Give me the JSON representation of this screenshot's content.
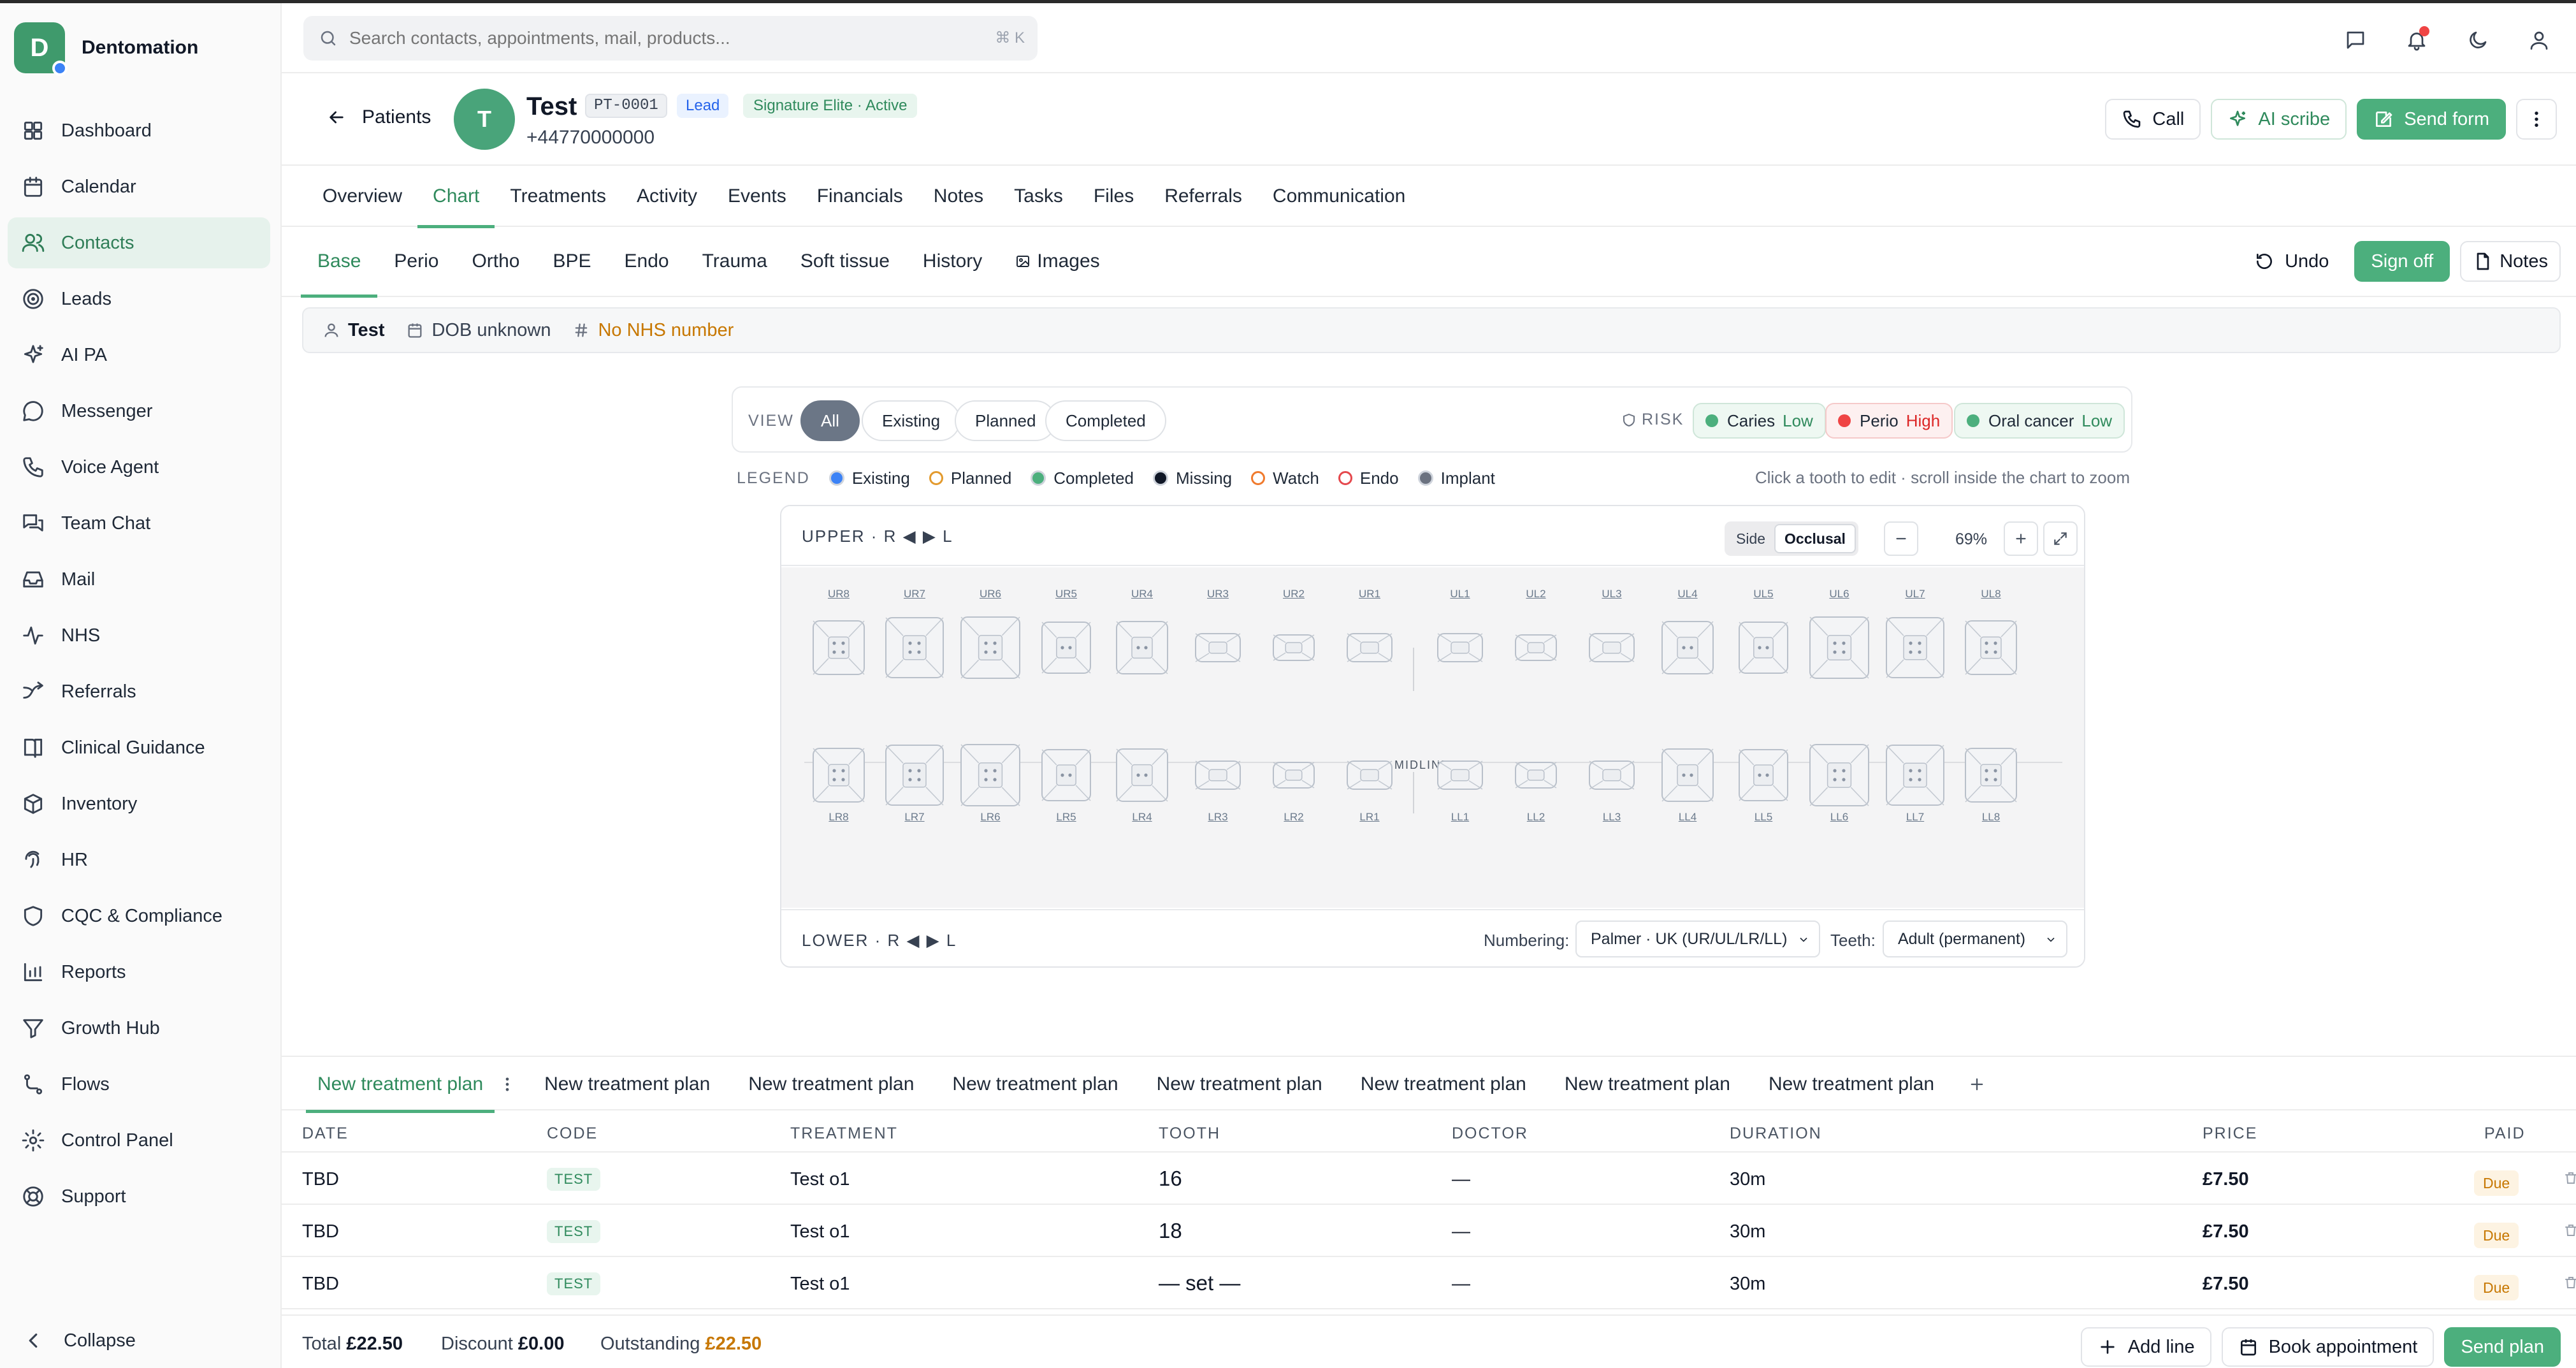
{
  "brand": {
    "initial": "D",
    "name": "Dentomation"
  },
  "sidebar": {
    "items": [
      {
        "label": "Dashboard",
        "icon": "dashboard-icon"
      },
      {
        "label": "Calendar",
        "icon": "calendar-icon"
      },
      {
        "label": "Contacts",
        "icon": "contacts-icon",
        "active": true
      },
      {
        "label": "Leads",
        "icon": "target-icon"
      },
      {
        "label": "AI PA",
        "icon": "sparkles-icon"
      },
      {
        "label": "Messenger",
        "icon": "message-circle-icon"
      },
      {
        "label": "Voice Agent",
        "icon": "phone-icon"
      },
      {
        "label": "Team Chat",
        "icon": "chat-bubbles-icon"
      },
      {
        "label": "Mail",
        "icon": "inbox-icon"
      },
      {
        "label": "NHS",
        "icon": "activity-icon"
      },
      {
        "label": "Referrals",
        "icon": "referral-icon"
      },
      {
        "label": "Clinical Guidance",
        "icon": "book-icon"
      },
      {
        "label": "Inventory",
        "icon": "package-icon"
      },
      {
        "label": "HR",
        "icon": "fingerprint-icon"
      },
      {
        "label": "CQC & Compliance",
        "icon": "shield-icon"
      },
      {
        "label": "Reports",
        "icon": "bar-chart-icon"
      },
      {
        "label": "Growth Hub",
        "icon": "funnel-icon"
      },
      {
        "label": "Flows",
        "icon": "flow-icon"
      },
      {
        "label": "Control Panel",
        "icon": "gear-icon"
      },
      {
        "label": "Support",
        "icon": "lifebuoy-icon"
      }
    ],
    "collapse_label": "Collapse"
  },
  "topbar": {
    "search_placeholder": "Search contacts, appointments, mail, products...",
    "search_shortcut": "⌘ K"
  },
  "patient": {
    "back_label": "Patients",
    "initial": "T",
    "name": "Test",
    "id": "PT-0001",
    "status": "Lead",
    "plan": "Signature Elite · Active",
    "phone": "+44770000000",
    "actions": {
      "call": "Call",
      "ai_scribe": "AI scribe",
      "send_form": "Send form"
    }
  },
  "main_tabs": [
    "Overview",
    "Chart",
    "Treatments",
    "Activity",
    "Events",
    "Financials",
    "Notes",
    "Tasks",
    "Files",
    "Referrals",
    "Communication"
  ],
  "main_tab_active": "Chart",
  "sub_tabs": [
    "Base",
    "Perio",
    "Ortho",
    "BPE",
    "Endo",
    "Trauma",
    "Soft tissue",
    "History",
    "Images"
  ],
  "sub_tab_active": "Base",
  "sub_actions": {
    "undo": "Undo",
    "sign_off": "Sign off",
    "notes": "Notes"
  },
  "strip": {
    "name": "Test",
    "dob": "DOB unknown",
    "nhs": "No NHS number"
  },
  "view": {
    "label": "VIEW",
    "options": [
      "All",
      "Existing",
      "Planned",
      "Completed"
    ],
    "active": "All"
  },
  "risk": {
    "label": "RISK",
    "items": [
      {
        "name": "Caries",
        "level": "Low",
        "color": "#4caf7d",
        "level_color": "#2f8a5c",
        "bg": "#eef8f2",
        "border": "#cfe6d9"
      },
      {
        "name": "Perio",
        "level": "High",
        "color": "#ef4444",
        "level_color": "#dc2626",
        "bg": "#fdf0f0",
        "border": "#f5c9c9"
      },
      {
        "name": "Oral cancer",
        "level": "Low",
        "color": "#4caf7d",
        "level_color": "#2f8a5c",
        "bg": "#eef8f2",
        "border": "#cfe6d9"
      }
    ]
  },
  "legend": {
    "label": "LEGEND",
    "items": [
      {
        "label": "Existing",
        "color": "#3b82f6",
        "style": "fill"
      },
      {
        "label": "Planned",
        "color": "#e39a2d",
        "style": "ring"
      },
      {
        "label": "Completed",
        "color": "#4caf7d",
        "style": "fill"
      },
      {
        "label": "Missing",
        "color": "#111827",
        "style": "fill"
      },
      {
        "label": "Watch",
        "color": "#f07a2d",
        "style": "ring"
      },
      {
        "label": "Endo",
        "color": "#e5484d",
        "style": "ring"
      },
      {
        "label": "Implant",
        "color": "#6b7280",
        "style": "fill"
      }
    ],
    "hint": "Click a tooth to edit · scroll inside the chart to zoom"
  },
  "odontogram": {
    "upper_title": "UPPER · R ◀ ▶ L",
    "lower_title": "LOWER · R ◀ ▶ L",
    "view_modes": [
      "Side",
      "Occlusal"
    ],
    "view_mode_active": "Occlusal",
    "zoom": "69%",
    "midline_label": "MIDLINE",
    "upper_teeth": [
      "UR8",
      "UR7",
      "UR6",
      "UR5",
      "UR4",
      "UR3",
      "UR2",
      "UR1",
      "UL1",
      "UL2",
      "UL3",
      "UL4",
      "UL5",
      "UL6",
      "UL7",
      "UL8"
    ],
    "lower_teeth": [
      "LR8",
      "LR7",
      "LR6",
      "LR5",
      "LR4",
      "LR3",
      "LR2",
      "LR1",
      "LL1",
      "LL2",
      "LL3",
      "LL4",
      "LL5",
      "LL6",
      "LL7",
      "LL8"
    ],
    "numbering_label": "Numbering:",
    "numbering_value": "Palmer · UK (UR/UL/LR/LL)",
    "teeth_label": "Teeth:",
    "teeth_value": "Adult (permanent)"
  },
  "plans": {
    "tabs": [
      "New treatment plan",
      "New treatment plan",
      "New treatment plan",
      "New treatment plan",
      "New treatment plan",
      "New treatment plan",
      "New treatment plan",
      "New treatment plan"
    ],
    "active_index": 0
  },
  "table": {
    "headers": {
      "date": "DATE",
      "code": "CODE",
      "treatment": "TREATMENT",
      "tooth": "TOOTH",
      "doctor": "DOCTOR",
      "duration": "DURATION",
      "price": "PRICE",
      "paid": "PAID"
    },
    "rows": [
      {
        "date": "TBD",
        "code": "TEST",
        "treatment": "Test o1",
        "tooth": "16",
        "doctor": "—",
        "duration": "30m",
        "price": "£7.50",
        "paid": "Due"
      },
      {
        "date": "TBD",
        "code": "TEST",
        "treatment": "Test o1",
        "tooth": "18",
        "doctor": "—",
        "duration": "30m",
        "price": "£7.50",
        "paid": "Due"
      },
      {
        "date": "TBD",
        "code": "TEST",
        "treatment": "Test o1",
        "tooth": "— set —",
        "doctor": "—",
        "duration": "30m",
        "price": "£7.50",
        "paid": "Due"
      }
    ]
  },
  "footer": {
    "total_label": "Total",
    "total": "£22.50",
    "discount_label": "Discount",
    "discount": "£0.00",
    "outstanding_label": "Outstanding",
    "outstanding": "£22.50",
    "add_line": "Add line",
    "book": "Book appointment",
    "send_plan": "Send plan"
  }
}
